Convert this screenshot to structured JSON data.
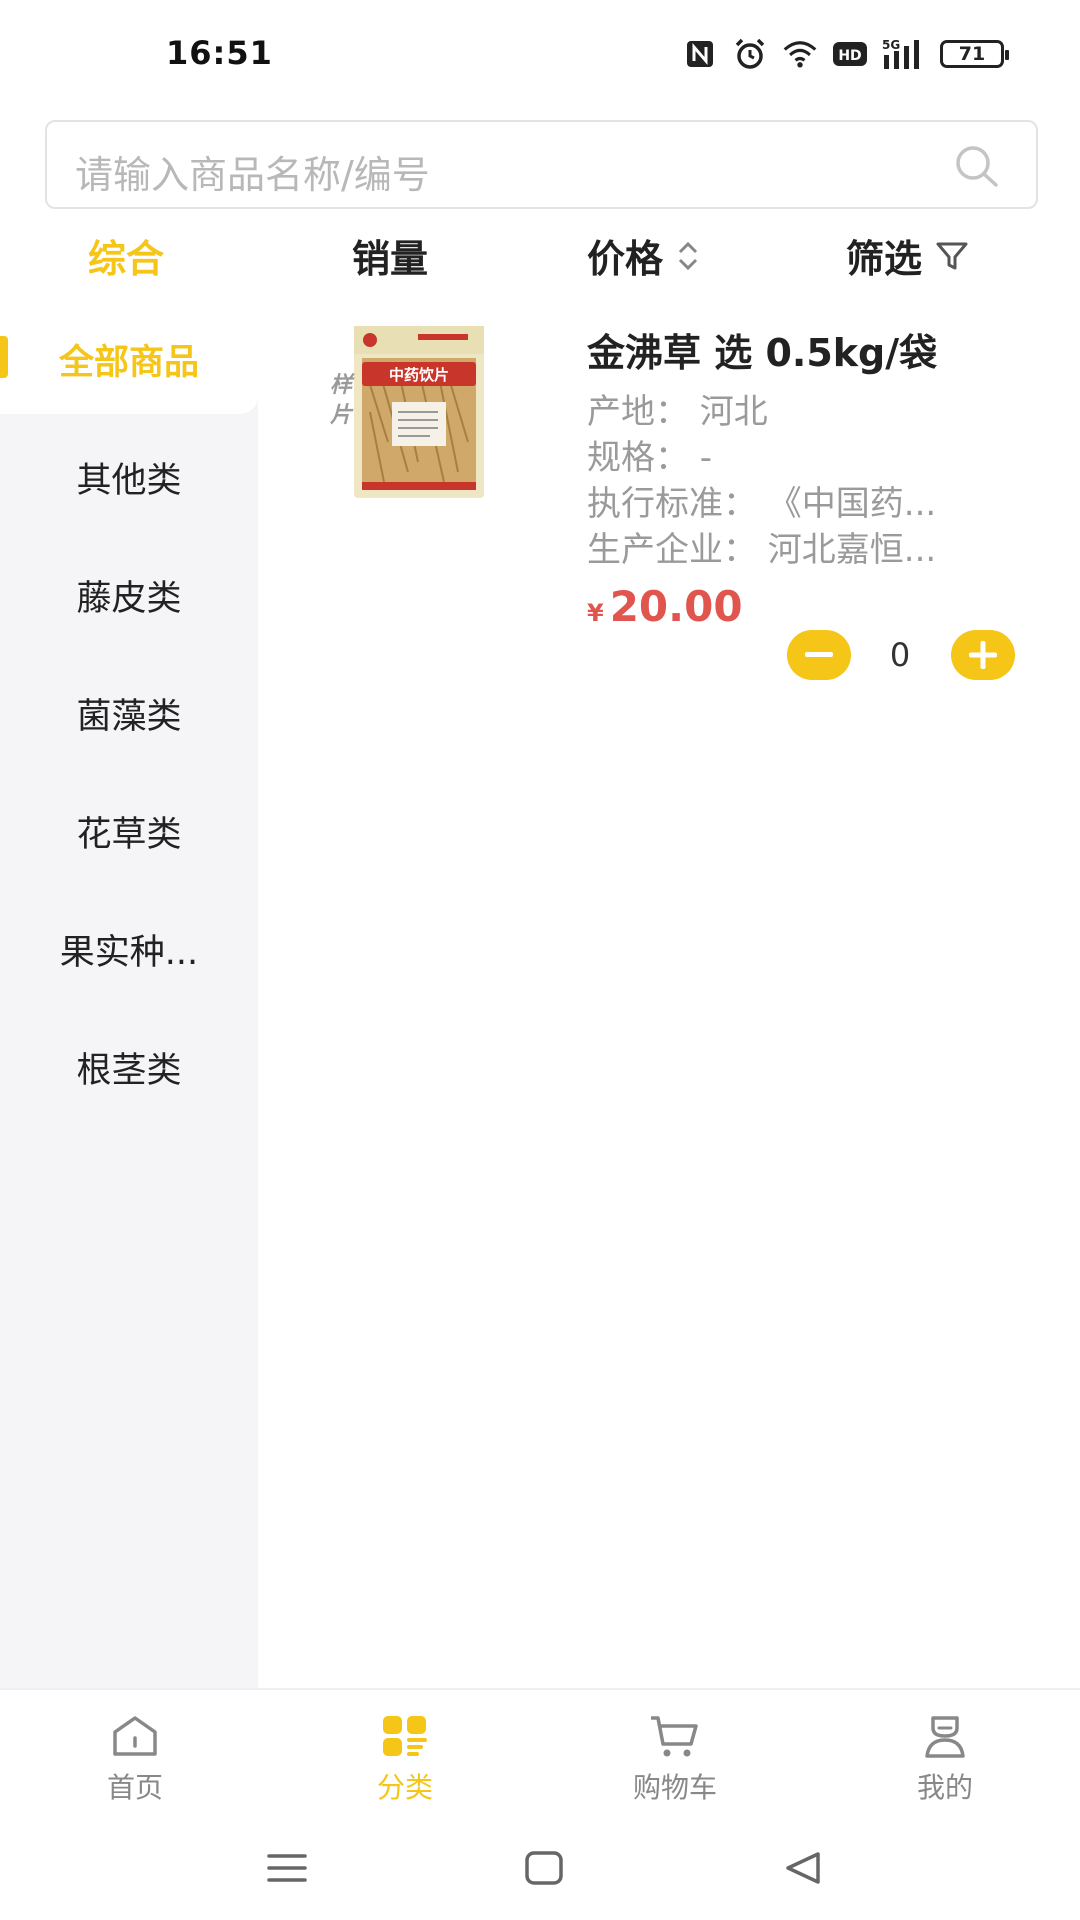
{
  "status_bar": {
    "time": "16:51",
    "battery": "71",
    "network": "5G",
    "hd": "HD",
    "icons": [
      "nfc-icon",
      "alarm-icon",
      "wifi-icon",
      "hd-icon",
      "signal-icon",
      "battery-icon"
    ]
  },
  "search": {
    "placeholder": "请输入商品名称/编号",
    "icon": "search-icon"
  },
  "sort_bar": {
    "items": [
      {
        "label": "综合",
        "active": true
      },
      {
        "label": "销量"
      },
      {
        "label": "价格",
        "icon": "sort-updown-icon"
      },
      {
        "label": "筛选",
        "icon": "filter-icon"
      }
    ]
  },
  "categories": [
    {
      "label": "全部商品",
      "active": true
    },
    {
      "label": "其他类"
    },
    {
      "label": "藤皮类"
    },
    {
      "label": "菌藻类"
    },
    {
      "label": "花草类"
    },
    {
      "label": "果实种..."
    },
    {
      "label": "根茎类"
    }
  ],
  "product": {
    "name": "金沸草 选 0.5kg/袋",
    "image_text": "中药饮片",
    "image_badge": "样片",
    "origin": "产地：  河北",
    "spec": "规格：  -",
    "standard": "执行标准：  《中国药...",
    "manufacturer": "生产企业：  河北嘉恒...",
    "price_symbol": "¥",
    "price": "20.00",
    "quantity": "0"
  },
  "tab_bar": {
    "tabs": [
      {
        "label": "首页",
        "icon": "home-icon"
      },
      {
        "label": "分类",
        "icon": "category-icon",
        "active": true
      },
      {
        "label": "购物车",
        "icon": "cart-icon"
      },
      {
        "label": "我的",
        "icon": "profile-icon"
      }
    ]
  },
  "nav_bar": {
    "buttons": [
      "menu-icon",
      "home-square-icon",
      "back-icon"
    ]
  },
  "colors": {
    "accent": "#f5c518",
    "price": "#e0564f",
    "sidebar_bg": "#f5f5f7",
    "muted_text": "#9a9a9a"
  }
}
